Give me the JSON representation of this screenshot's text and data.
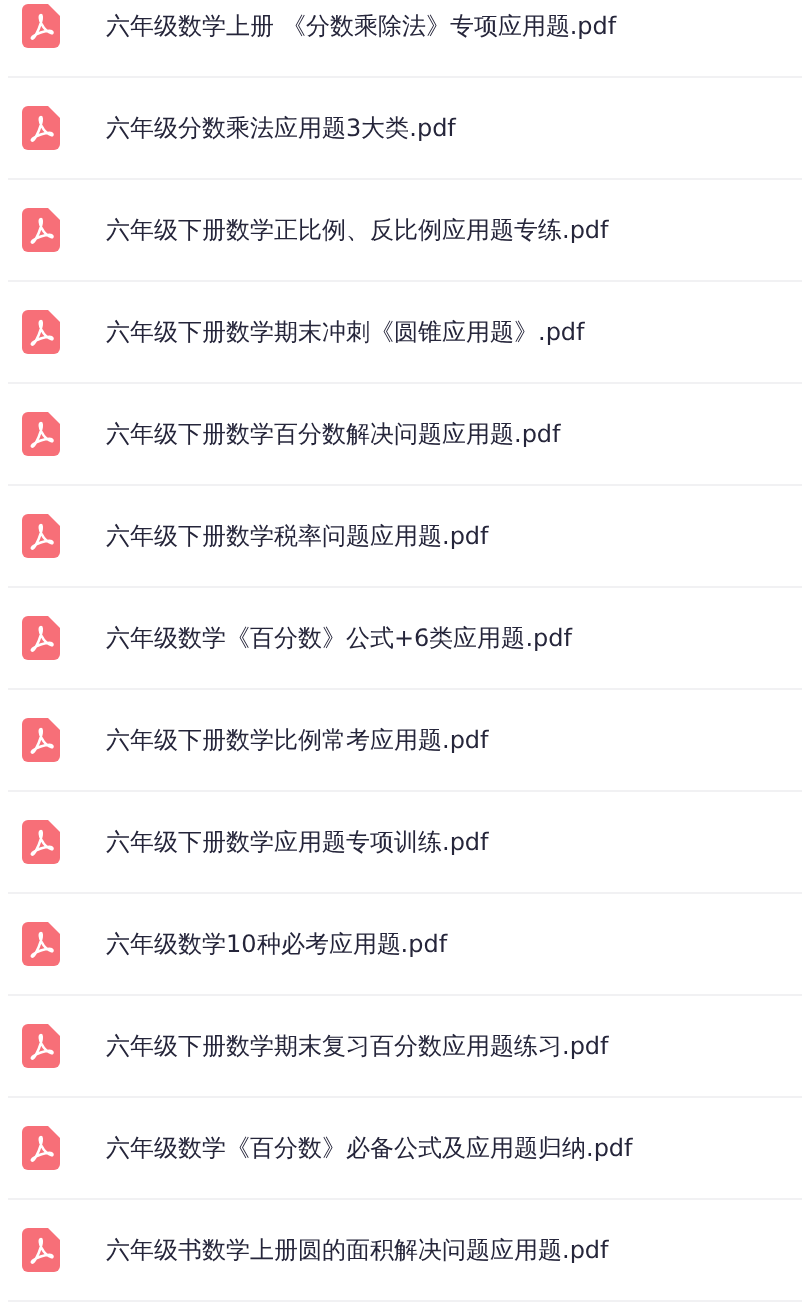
{
  "files": [
    {
      "name": "六年级数学上册 《分数乘除法》专项应用题.pdf"
    },
    {
      "name": "六年级分数乘法应用题3大类.pdf"
    },
    {
      "name": "六年级下册数学正比例、反比例应用题专练.pdf"
    },
    {
      "name": "六年级下册数学期末冲刺《圆锥应用题》.pdf"
    },
    {
      "name": "六年级下册数学百分数解决问题应用题.pdf"
    },
    {
      "name": "六年级下册数学税率问题应用题.pdf"
    },
    {
      "name": "六年级数学《百分数》公式+6类应用题.pdf"
    },
    {
      "name": "六年级下册数学比例常考应用题.pdf"
    },
    {
      "name": "六年级下册数学应用题专项训练.pdf"
    },
    {
      "name": "六年级数学10种必考应用题.pdf"
    },
    {
      "name": "六年级下册数学期末复习百分数应用题练习.pdf"
    },
    {
      "name": "六年级数学《百分数》必备公式及应用题归纳.pdf"
    },
    {
      "name": "六年级书数学上册圆的面积解决问题应用题.pdf"
    }
  ]
}
